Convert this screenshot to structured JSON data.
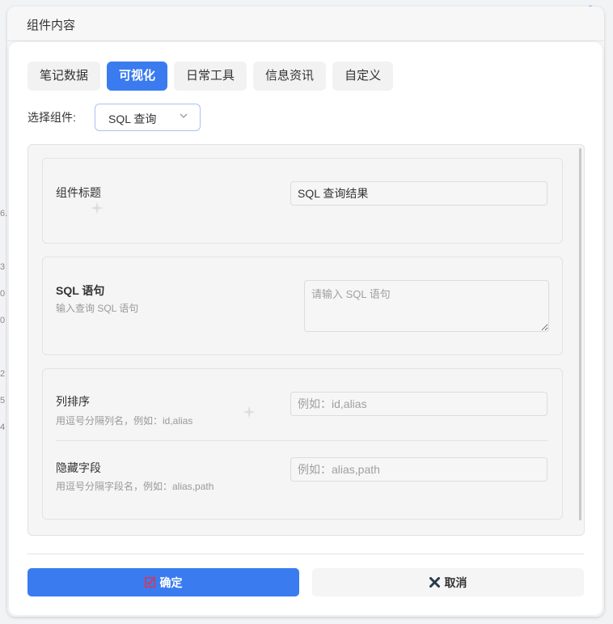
{
  "panel": {
    "title": "组件内容"
  },
  "tabs": [
    {
      "label": "笔记数据"
    },
    {
      "label": "可视化",
      "active": true
    },
    {
      "label": "日常工具"
    },
    {
      "label": "信息资讯"
    },
    {
      "label": "自定义"
    }
  ],
  "component_select": {
    "label": "选择组件:",
    "value": "SQL 查询"
  },
  "fields": {
    "title": {
      "label": "组件标题",
      "value": "SQL 查询结果"
    },
    "sql": {
      "label": "SQL 语句",
      "description": "输入查询 SQL 语句",
      "placeholder": "请输入 SQL 语句"
    },
    "column_order": {
      "label": "列排序",
      "description": "用逗号分隔列名，例如：id,alias",
      "placeholder": "例如：id,alias"
    },
    "hidden_fields": {
      "label": "隐藏字段",
      "description": "用逗号分隔字段名，例如：alias,path",
      "placeholder": "例如：alias,path"
    }
  },
  "buttons": {
    "confirm": "确定",
    "cancel": "取消"
  },
  "edge_marks": [
    "6.",
    "3",
    "0",
    "0",
    "2",
    "5",
    "4"
  ],
  "colors": {
    "accent": "#3a7bf0",
    "confirm_icon": "#e0334a",
    "cancel_icon": "#2a3a4a"
  }
}
